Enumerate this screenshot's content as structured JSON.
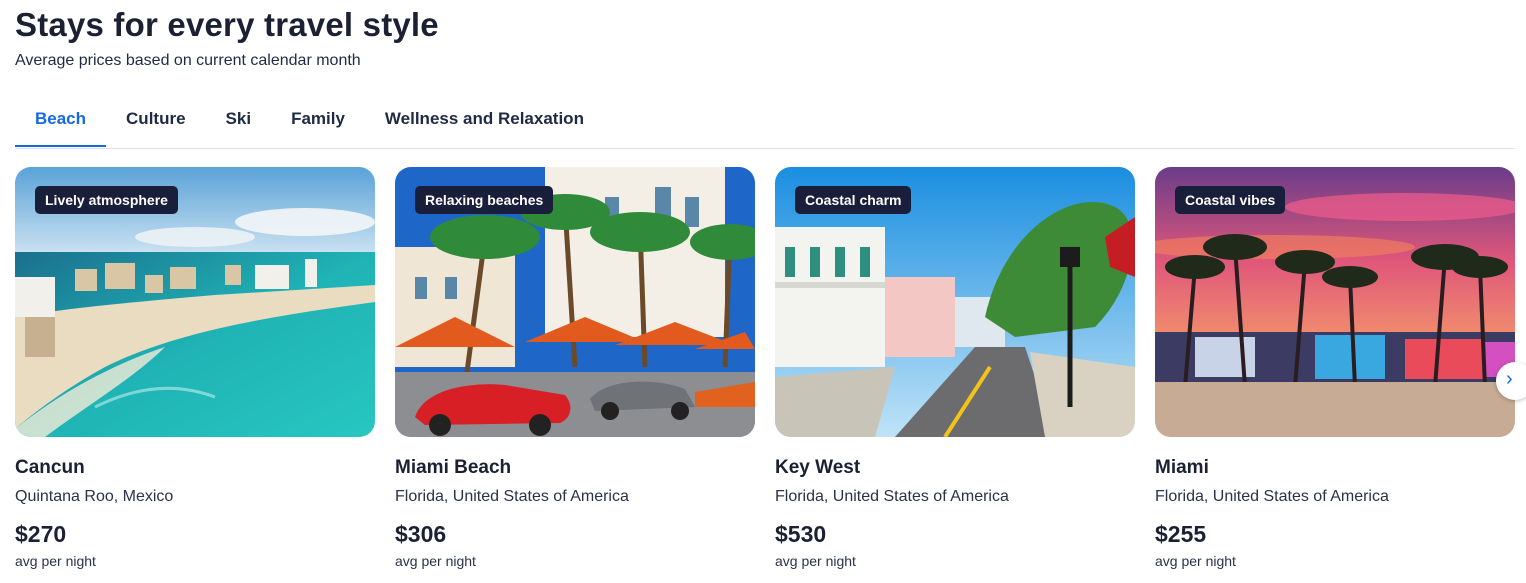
{
  "header": {
    "title": "Stays for every travel style",
    "subtitle": "Average prices based on current calendar month"
  },
  "tabs": [
    {
      "label": "Beach",
      "active": true
    },
    {
      "label": "Culture",
      "active": false
    },
    {
      "label": "Ski",
      "active": false
    },
    {
      "label": "Family",
      "active": false
    },
    {
      "label": "Wellness and Relaxation",
      "active": false
    }
  ],
  "cards": [
    {
      "badge": "Lively atmosphere",
      "city": "Cancun",
      "region": "Quintana Roo, Mexico",
      "price": "$270",
      "per": "avg per night"
    },
    {
      "badge": "Relaxing beaches",
      "city": "Miami Beach",
      "region": "Florida, United States of America",
      "price": "$306",
      "per": "avg per night"
    },
    {
      "badge": "Coastal charm",
      "city": "Key West",
      "region": "Florida, United States of America",
      "price": "$530",
      "per": "avg per night"
    },
    {
      "badge": "Coastal vibes",
      "city": "Miami",
      "region": "Florida, United States of America",
      "price": "$255",
      "per": "avg per night"
    }
  ],
  "carousel": {
    "next_icon": "chevron-right-icon",
    "next_glyph": "›"
  },
  "colors": {
    "accent": "#1668e3",
    "badge_bg": "#191e3b",
    "text": "#1b2133"
  }
}
